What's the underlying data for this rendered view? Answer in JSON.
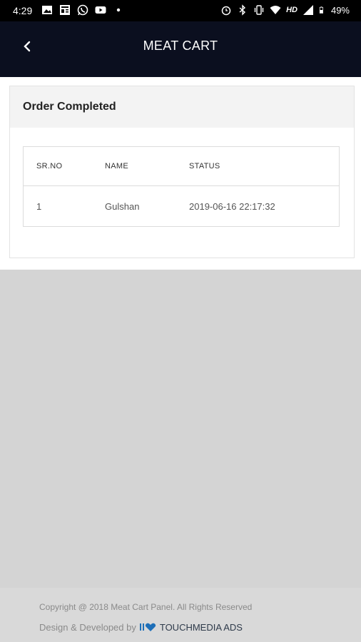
{
  "status_bar": {
    "time": "4:29",
    "network": "HD",
    "battery": "49%",
    "left_icons": [
      "image-icon",
      "news-icon",
      "whatsapp-icon",
      "youtube-icon",
      "dot-icon"
    ],
    "right_icons": [
      "alarm-icon",
      "bluetooth-icon",
      "vibrate-icon",
      "wifi-icon",
      "signal-icon",
      "battery-icon"
    ]
  },
  "appbar": {
    "title": "MEAT CART"
  },
  "card": {
    "title": "Order Completed",
    "columns": [
      "SR.NO",
      "NAME",
      "STATUS"
    ],
    "rows": [
      {
        "sr_no": "1",
        "name": "Gulshan",
        "status": "2019-06-16 22:17:32"
      }
    ]
  },
  "footer": {
    "copyright": "Copyright @ 2018 Meat Cart Panel. All Rights Reserved",
    "developed_by": "Design & Developed by",
    "brand": "TOUCHMEDIA ADS",
    "brand_color": "#1e6fb8"
  }
}
